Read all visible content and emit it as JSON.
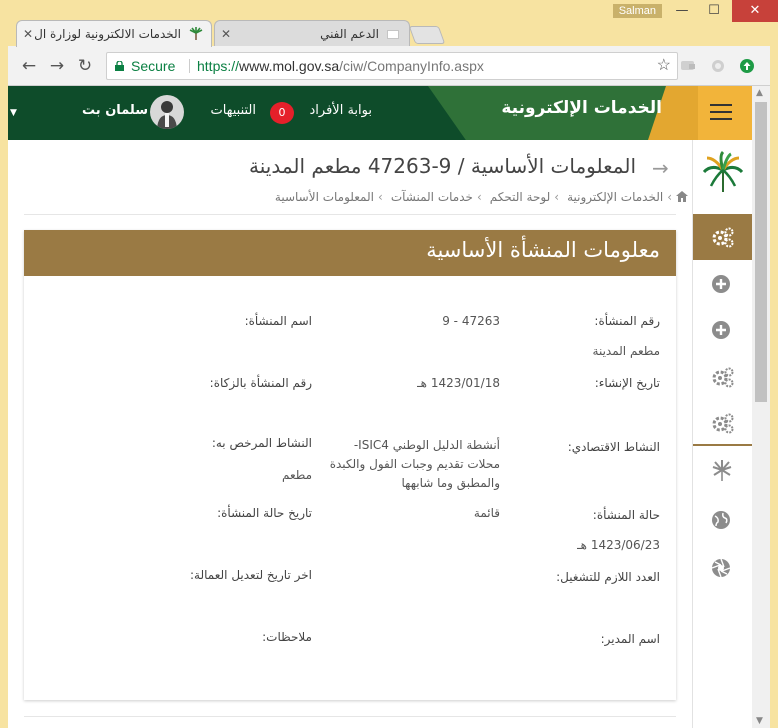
{
  "window": {
    "user": "Salman",
    "minimize": "—",
    "maximize": "☐",
    "close": "✕"
  },
  "tabs": [
    {
      "title": "الخدمات الالكترونية لوزارة ال",
      "active": true
    },
    {
      "title": "الدعم الفني",
      "active": false
    }
  ],
  "address_bar": {
    "secure_label": "Secure",
    "url_scheme": "https://",
    "url_host": "www.mol.gov.sa",
    "url_path": "/ciw/CompanyInfo.aspx"
  },
  "header": {
    "brand": "الخدمات الإلكترونية",
    "portal_link": "بوابة الأفراد",
    "notifications_label": "التنبيهات",
    "notifications_count": "0",
    "user_name": "سلمان بت"
  },
  "page": {
    "title": "المعلومات الأساسية / 9-47263 مطعم المدينة",
    "breadcrumb": [
      "الخدمات الإلكترونية",
      "لوحة التحكم",
      "خدمات المنشآت",
      "المعلومات الأساسية"
    ]
  },
  "card": {
    "title": "معلومات المنشأة الأساسية",
    "fields": {
      "establishment_number_label": "رقم المنشأة:",
      "establishment_number_value": "9 - 47263",
      "establishment_name_label": "اسم المنشأة:",
      "establishment_name_value": "مطعم المدينة",
      "creation_date_label": "تاريخ الإنشاء:",
      "creation_date_value": "1423/01/18 هـ",
      "zakat_number_label": "رقم المنشأة بالزكاة:",
      "economic_activity_label": "النشاط الاقتصادي:",
      "economic_activity_value": "أنشطة الدليل الوطني ISIC4- محلات تقديم وجبات الفول والكبدة والمطبق وما شابهها",
      "licensed_activity_label": "النشاط المرخص به:",
      "licensed_activity_value": "مطعم",
      "status_label": "حالة المنشأة:",
      "status_value": "قائمة",
      "status_date_label": "تاريخ حالة المنشأة:",
      "status_date_value": "1423/06/23 هـ",
      "required_workers_label": "العدد اللازم للتشغيل:",
      "last_labor_update_label": "اخر تاريخ لتعديل العمالة:",
      "manager_name_label": "اسم المدير:",
      "notes_label": "ملاحظات:"
    }
  },
  "colors": {
    "header_dark_green": "#0e4c2a",
    "header_green": "#2f7138",
    "header_gold": "#f2b43a",
    "card_header_brown": "#9a7a44",
    "badge_red": "#e5202a"
  },
  "icons": {
    "sidebar": [
      "palm-logo-icon",
      "gears-icon",
      "plus-circle-icon",
      "plus-circle-icon",
      "gears-icon",
      "gears-icon",
      "palm-icon",
      "globe-icon",
      "aperture-icon"
    ]
  }
}
